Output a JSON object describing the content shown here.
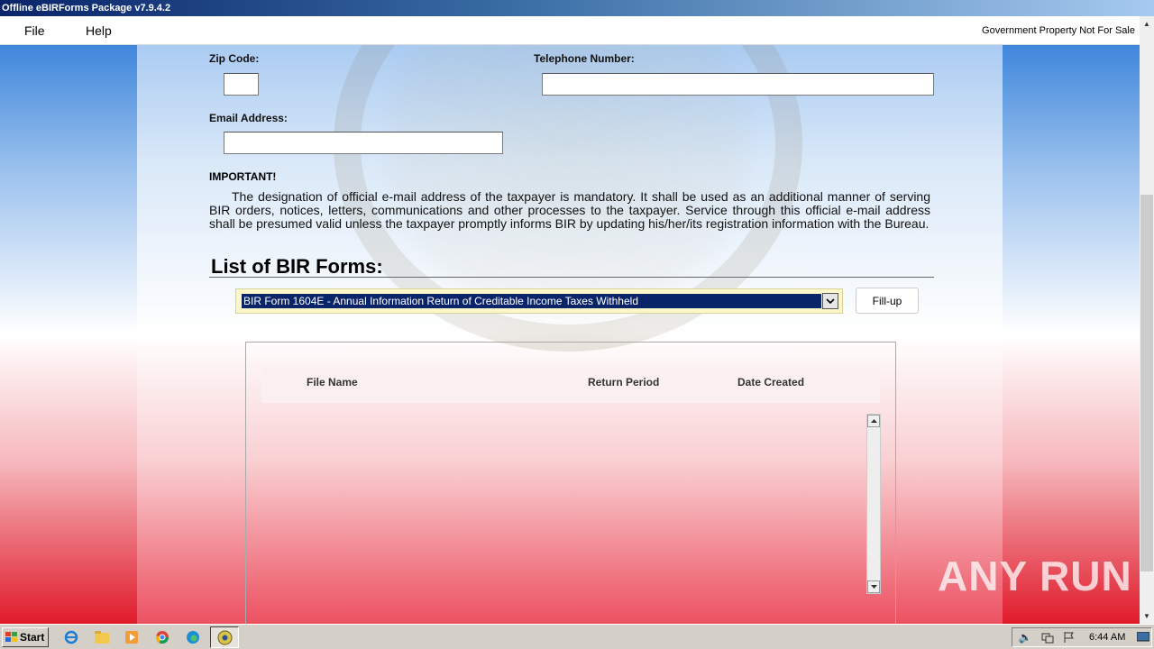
{
  "window": {
    "title": "Offline eBIRForms Package v7.9.4.2"
  },
  "menu": {
    "file": "File",
    "help": "Help",
    "notice": "Government Property Not For Sale"
  },
  "form": {
    "zip_label": "Zip Code:",
    "zip_value": "",
    "telephone_label": "Telephone Number:",
    "telephone_value": "",
    "email_label": "Email Address:",
    "email_value": ""
  },
  "important": {
    "title": "IMPORTANT!",
    "text": "The designation of official e-mail address of the taxpayer is mandatory. It shall be used as an additional manner of serving BIR orders, notices, letters, communications and other processes to the taxpayer. Service through this official e-mail address shall be presumed valid unless the taxpayer promptly informs BIR by updating his/her/its registration information with the Bureau."
  },
  "forms_list": {
    "heading": "List of BIR Forms:",
    "selected": "BIR Form 1604E - Annual Information Return of Creditable Income Taxes Withheld",
    "fillup_label": "Fill-up"
  },
  "files_table": {
    "columns": [
      "File Name",
      "Return Period",
      "Date Created"
    ],
    "rows": []
  },
  "watermark": "ANY RUN",
  "taskbar": {
    "start_label": "Start",
    "clock": "6:44 AM",
    "icons": [
      "ie-icon",
      "explorer-icon",
      "media-player-icon",
      "chrome-icon",
      "edge-icon",
      "ebirforms-icon"
    ]
  },
  "colors": {
    "selection": "#0a246a",
    "select_bg": "#fbf7c9",
    "top_blue": "#3f86dc",
    "bottom_red": "#e01a2b"
  }
}
